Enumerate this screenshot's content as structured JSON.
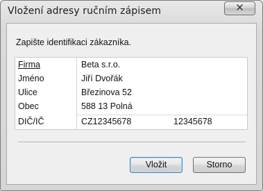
{
  "window": {
    "title": "Vložení adresy ručním zápisem",
    "close_glyph": "✕"
  },
  "prompt": "Zapište identifikaci zákazníka.",
  "form": {
    "rows": [
      {
        "label": "Firma",
        "value": "Beta s.r.o."
      },
      {
        "label": "Jméno",
        "value": "Jiří Dvořák"
      },
      {
        "label": "Ulice",
        "value": "Březinova 52"
      },
      {
        "label": "Obec",
        "value": "588 13  Polná"
      },
      {
        "label": "DIČ/IČ",
        "value": "CZ12345678",
        "value2": "12345678"
      }
    ]
  },
  "buttons": {
    "ok": "Vložit",
    "cancel": "Storno"
  },
  "icons": {
    "close": "close-icon"
  }
}
